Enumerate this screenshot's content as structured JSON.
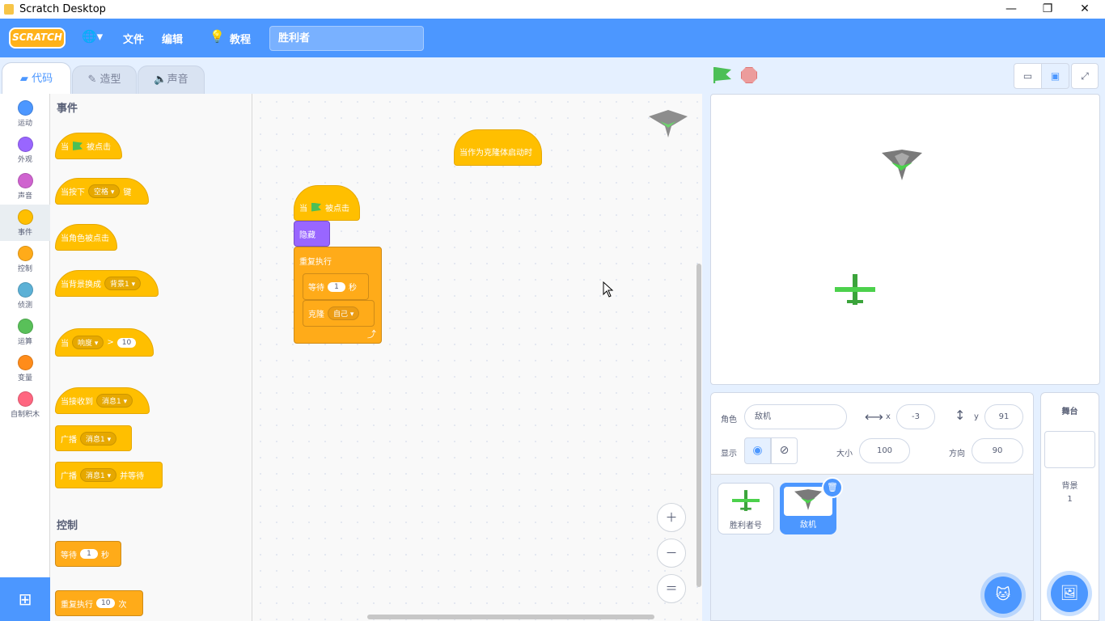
{
  "window": {
    "title": "Scratch Desktop",
    "minimize": "—",
    "restore": "❐",
    "close": "✕"
  },
  "menu": {
    "logo": "SCRATCH",
    "globe": "🌐▾",
    "file": "文件",
    "edit": "编辑",
    "tutorial": "教程",
    "project_title": "胜利者"
  },
  "tabs": [
    {
      "label": "代码"
    },
    {
      "label": "造型"
    },
    {
      "label": "声音"
    }
  ],
  "categories": [
    {
      "label": "运动",
      "color": "#4c97ff"
    },
    {
      "label": "外观",
      "color": "#9966ff"
    },
    {
      "label": "声音",
      "color": "#cf63cf"
    },
    {
      "label": "事件",
      "color": "#ffbf00"
    },
    {
      "label": "控制",
      "color": "#ffab19"
    },
    {
      "label": "侦测",
      "color": "#5cb1d6"
    },
    {
      "label": "运算",
      "color": "#59c059"
    },
    {
      "label": "变量",
      "color": "#ff8c1a"
    },
    {
      "label": "自制积木",
      "color": "#ff6680"
    }
  ],
  "palette": {
    "events_title": "事件",
    "b1": {
      "pre": "当",
      "post": "被点击"
    },
    "b2": {
      "pre": "当按下",
      "dd": "空格",
      "post": "键"
    },
    "b3": {
      "text": "当角色被点击"
    },
    "b4": {
      "pre": "当背景换成",
      "dd": "背景1"
    },
    "b5": {
      "pre": "当",
      "dd": "响度",
      "op": ">",
      "val": "10"
    },
    "b6": {
      "pre": "当接收到",
      "dd": "消息1"
    },
    "b7": {
      "pre": "广播",
      "dd": "消息1"
    },
    "b8": {
      "pre": "广播",
      "dd": "消息1",
      "post": "并等待"
    },
    "control_title": "控制",
    "c1": {
      "pre": "等待",
      "val": "1",
      "post": "秒"
    },
    "c2": {
      "pre": "重复执行",
      "val": "10",
      "post": "次"
    }
  },
  "workspace": {
    "clone_hat": "当作为克隆体启动时",
    "flag_hat": {
      "pre": "当",
      "post": "被点击"
    },
    "hide": "隐藏",
    "forever": "重复执行",
    "wait": {
      "pre": "等待",
      "val": "1",
      "post": "秒"
    },
    "clone": {
      "pre": "克隆",
      "dd": "自己"
    },
    "zoom_in": "＋",
    "zoom_out": "－",
    "zoom_reset": "＝"
  },
  "sprite_info": {
    "sprite_label": "角色",
    "sprite_name": "敌机",
    "x_label": "x",
    "x": "-3",
    "y_label": "y",
    "y": "91",
    "show_label": "显示",
    "size_label": "大小",
    "size": "100",
    "direction_label": "方向",
    "direction": "90"
  },
  "sprites": [
    {
      "name": "胜利者号",
      "selected": false
    },
    {
      "name": "敌机",
      "selected": true
    }
  ],
  "stage_panel": {
    "title": "舞台",
    "backdrop_label": "背景",
    "backdrop_count": "1"
  }
}
